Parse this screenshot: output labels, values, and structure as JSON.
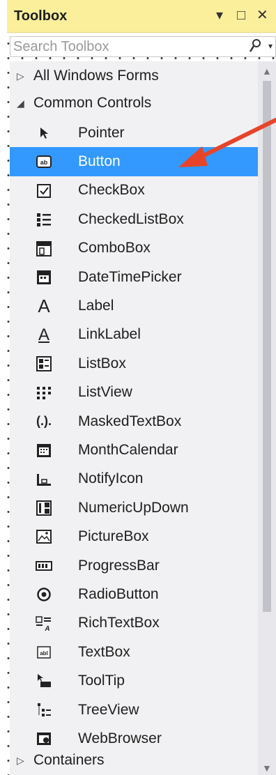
{
  "title": "Toolbox",
  "window_controls": {
    "dropdown": "▾",
    "maximize": "□",
    "close": "✕"
  },
  "search": {
    "placeholder": "Search Toolbox"
  },
  "groups": {
    "all_windows_forms": "All Windows Forms",
    "common_controls": "Common Controls",
    "containers": "Containers"
  },
  "items": [
    "Pointer",
    "Button",
    "CheckBox",
    "CheckedListBox",
    "ComboBox",
    "DateTimePicker",
    "Label",
    "LinkLabel",
    "ListBox",
    "ListView",
    "MaskedTextBox",
    "MonthCalendar",
    "NotifyIcon",
    "NumericUpDown",
    "PictureBox",
    "ProgressBar",
    "RadioButton",
    "RichTextBox",
    "TextBox",
    "ToolTip",
    "TreeView",
    "WebBrowser"
  ],
  "selected_item": "Button",
  "colors": {
    "title_bar": "#fbef9c",
    "selection": "#3399ff",
    "annotation_arrow": "#e8442a"
  }
}
